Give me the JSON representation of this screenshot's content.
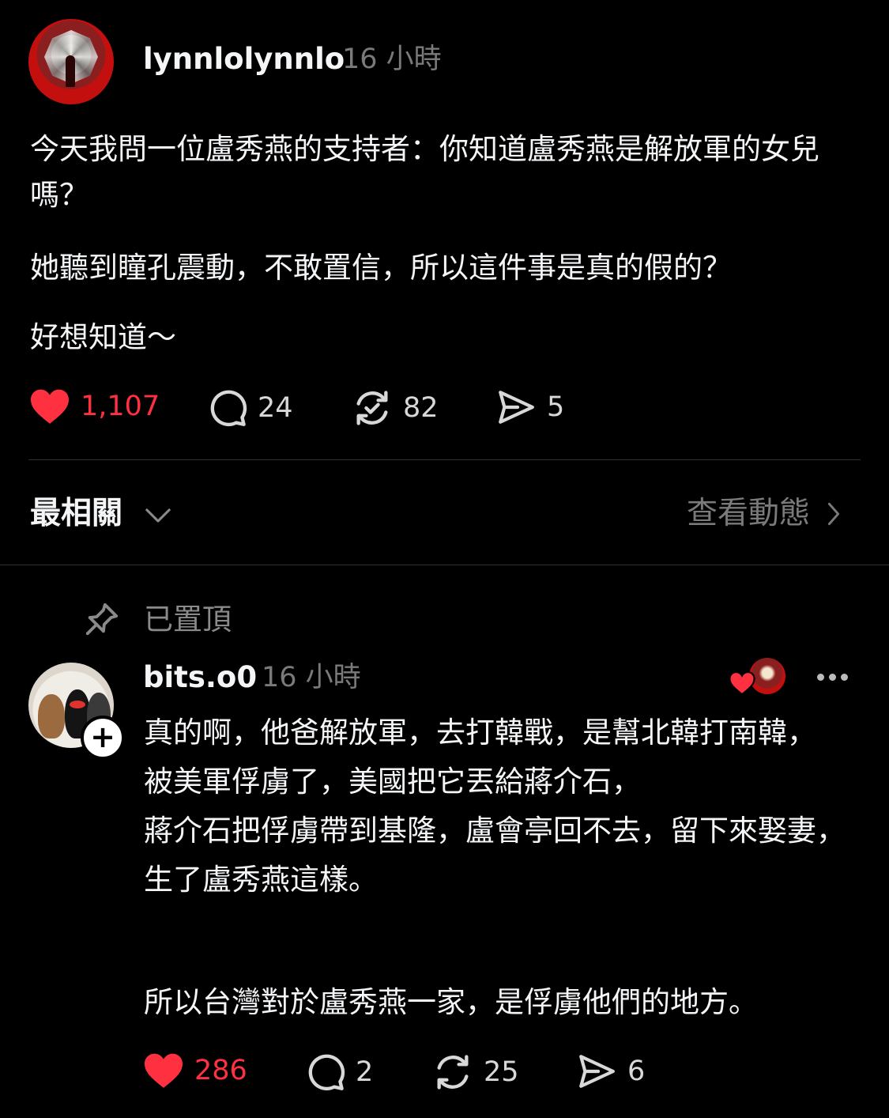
{
  "post": {
    "username": "lynnlolynnlo",
    "time": "16 小時",
    "paragraphs": [
      "今天我問一位盧秀燕的支持者：你知道盧秀燕是解放軍的女兒嗎？",
      "她聽到瞳孔震動，不敢置信，所以這件事是真的假的？",
      "好想知道～"
    ],
    "likes": "1,107",
    "comments": "24",
    "reposts": "82",
    "shares": "5"
  },
  "replies_header": {
    "sort_label": "最相關",
    "activity_link": "查看動態"
  },
  "reply": {
    "pinned_label": "已置頂",
    "username": "bits.o0",
    "time": "16 小時",
    "text_main": "真的啊，他爸解放軍，去打韓戰，是幫北韓打南韓，\n被美軍俘虜了，美國把它丟給蔣介石，\n蔣介石把俘虜帶到基隆，盧會亭回不去，留下來娶妻，生了盧秀燕這樣。",
    "text_second": "所以台灣對於盧秀燕一家，是俘虜他們的地方。",
    "likes": "286",
    "comments": "2",
    "reposts": "25",
    "shares": "6"
  },
  "colors": {
    "background": "#000000",
    "like_red": "#ff3040",
    "muted_text": "#7a7a7a",
    "divider": "#2f2f2f"
  },
  "icons": [
    "heart-icon",
    "comment-icon",
    "repost-icon",
    "share-icon",
    "chevron-down-icon",
    "chevron-right-icon",
    "pin-icon",
    "plus-icon",
    "more-icon"
  ]
}
